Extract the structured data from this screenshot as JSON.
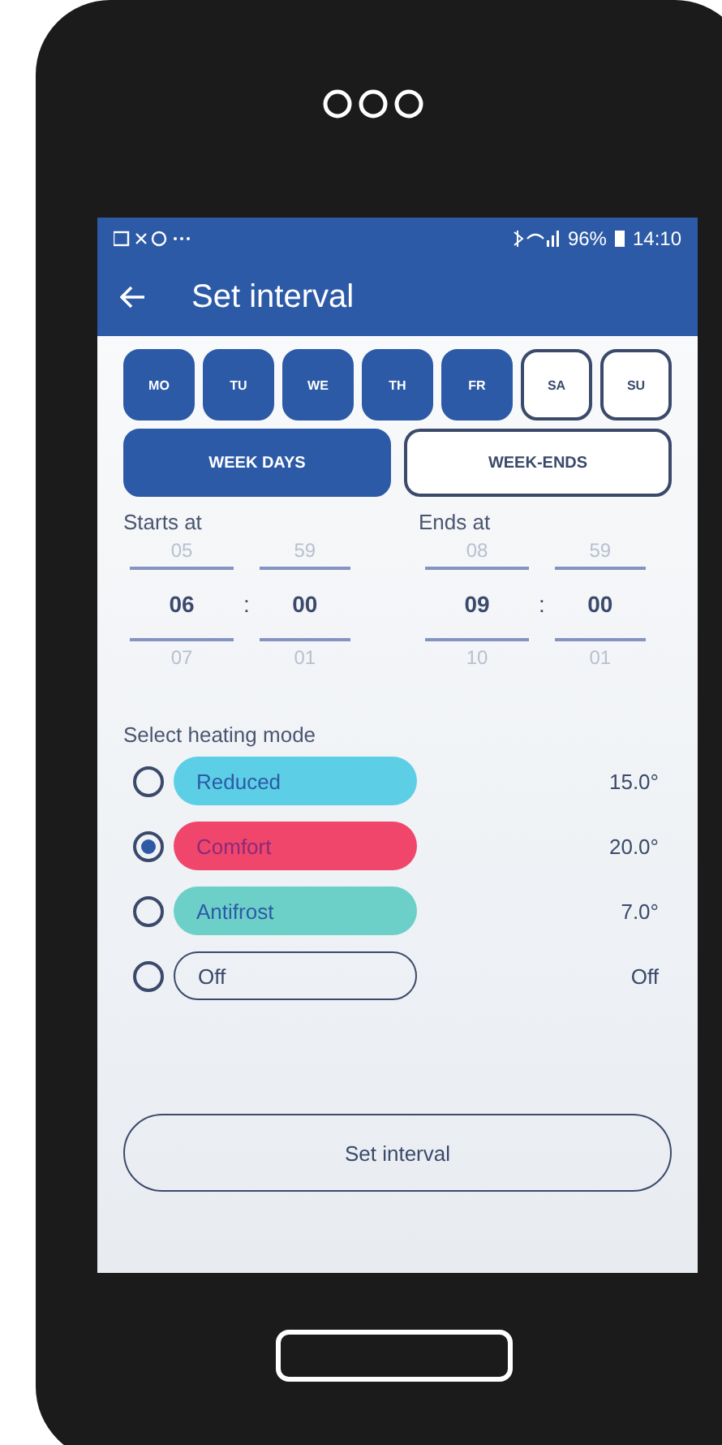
{
  "status_bar": {
    "battery": "96%",
    "time": "14:10"
  },
  "header": {
    "title": "Set interval"
  },
  "days": [
    {
      "label": "MO",
      "selected": true
    },
    {
      "label": "TU",
      "selected": true
    },
    {
      "label": "WE",
      "selected": true
    },
    {
      "label": "TH",
      "selected": true
    },
    {
      "label": "FR",
      "selected": true
    },
    {
      "label": "SA",
      "selected": false
    },
    {
      "label": "SU",
      "selected": false
    }
  ],
  "day_groups": [
    {
      "label": "WEEK DAYS",
      "selected": true
    },
    {
      "label": "WEEK-ENDS",
      "selected": false
    }
  ],
  "times": [
    {
      "label": "Starts at",
      "separator": ":",
      "hour": {
        "prev": "05",
        "value": "06",
        "next": "07"
      },
      "minute": {
        "prev": "59",
        "value": "00",
        "next": "01"
      }
    },
    {
      "label": "Ends at",
      "separator": ":",
      "hour": {
        "prev": "08",
        "value": "09",
        "next": "10"
      },
      "minute": {
        "prev": "59",
        "value": "00",
        "next": "01"
      }
    }
  ],
  "heating_mode": {
    "label": "Select heating mode",
    "modes": [
      {
        "name": "Reduced",
        "color": "#5ccfe6",
        "selected": false,
        "value": "15.0°"
      },
      {
        "name": "Comfort",
        "color": "#f0466c",
        "selected": true,
        "value": "20.0°"
      },
      {
        "name": "Antifrost",
        "color": "#6dd0c8",
        "selected": false,
        "value": "7.0°"
      },
      {
        "name": "Off",
        "selected": false,
        "value": "Off"
      }
    ]
  },
  "action_button": "Set interval"
}
